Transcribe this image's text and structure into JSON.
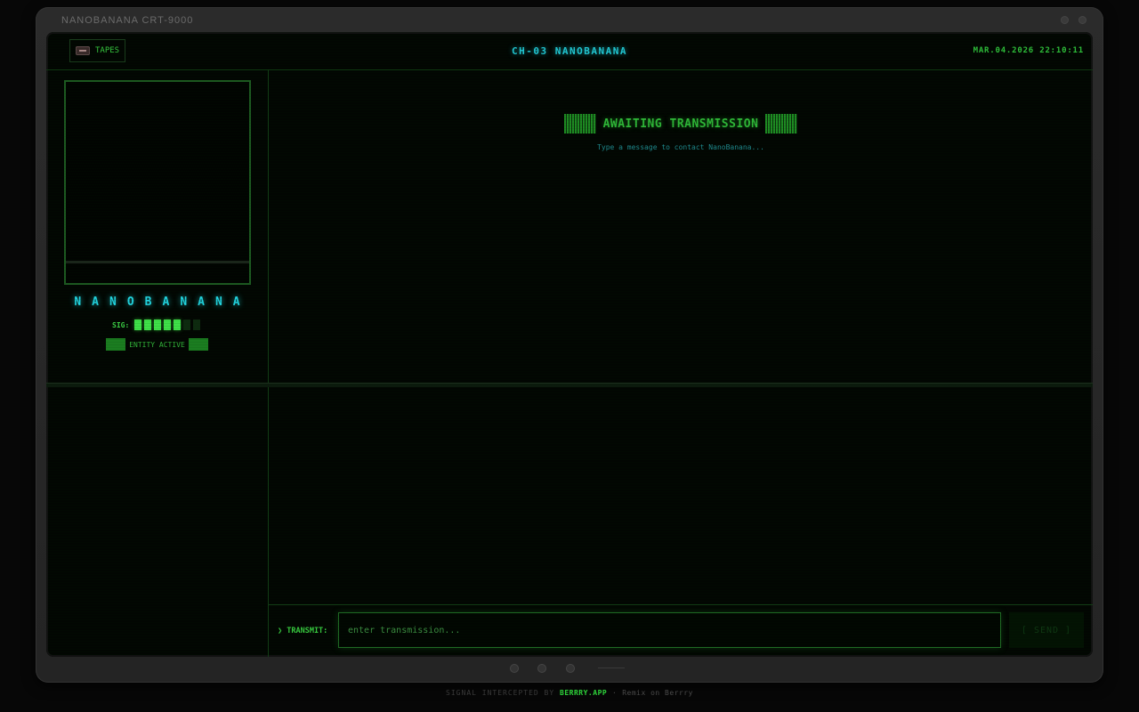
{
  "device": {
    "brand": "NANOBANANA CRT-9000"
  },
  "topbar": {
    "tapes_label": "TAPES",
    "channel": "CH-03 NANOBANANA",
    "datetime": "MAR.04.2026 22:10:11"
  },
  "sidebar": {
    "entity_name": "NANOBANANA",
    "signal_label": "SIG:",
    "signal_level": 5,
    "signal_max": 7,
    "status_text": "ENTITY ACTIVE"
  },
  "main": {
    "awaiting_title": "AWAITING TRANSMISSION",
    "hint": "Type a message to contact NanoBanana..."
  },
  "input_bar": {
    "prompt_label": "❯ TRANSMIT:",
    "placeholder": "enter transmission...",
    "send_label": "[ SEND ]"
  },
  "footer": {
    "prefix": "SIGNAL INTERCEPTED BY",
    "app_name": "BERRRY.APP",
    "separator": "·",
    "remix": "Remix on Berrry"
  },
  "colors": {
    "phosphor_green": "#2fc13b",
    "cyan": "#22c9d6",
    "screen_bg": "#020602"
  }
}
